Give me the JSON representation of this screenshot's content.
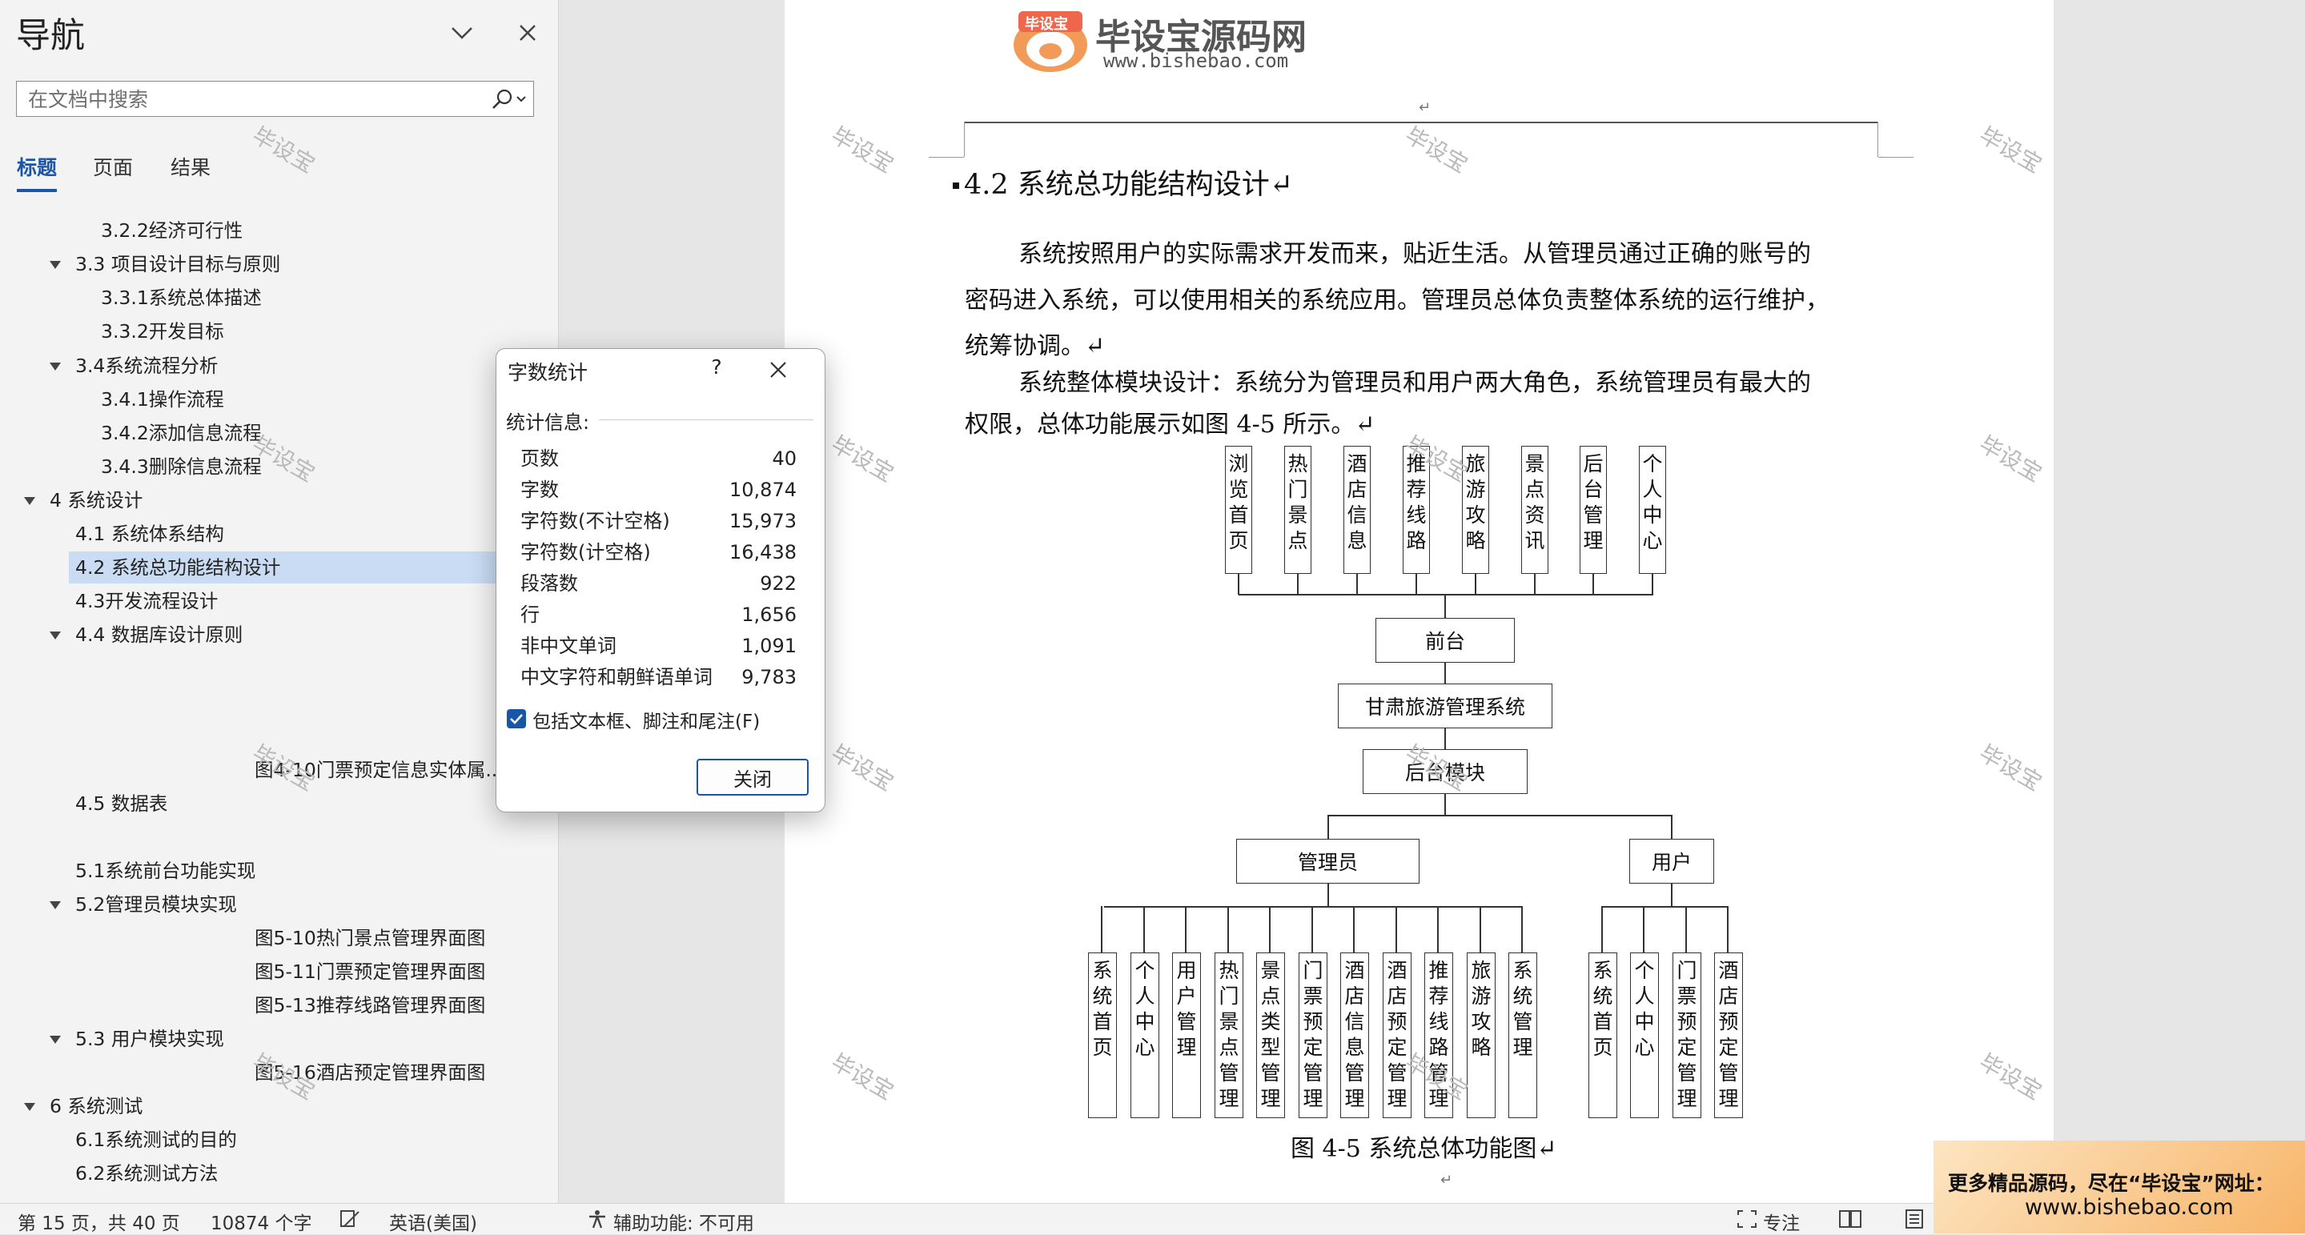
{
  "nav": {
    "title": "导航",
    "search_placeholder": "在文档中搜索",
    "tabs": [
      "标题",
      "页面",
      "结果"
    ],
    "items": [
      {
        "label": "3.2.2经济可行性",
        "level": 3,
        "expand": false
      },
      {
        "label": "3.3 项目设计目标与原则",
        "level": 2,
        "expand": true
      },
      {
        "label": "3.3.1系统总体描述",
        "level": 3,
        "expand": false
      },
      {
        "label": "3.3.2开发目标",
        "level": 3,
        "expand": false
      },
      {
        "label": "3.4系统流程分析",
        "level": 2,
        "expand": true
      },
      {
        "label": "3.4.1操作流程",
        "level": 3,
        "expand": false
      },
      {
        "label": "3.4.2添加信息流程",
        "level": 3,
        "expand": false
      },
      {
        "label": "3.4.3删除信息流程",
        "level": 3,
        "expand": false
      },
      {
        "label": "4 系统设计",
        "level": 1,
        "expand": true
      },
      {
        "label": "4.1 系统体系结构",
        "level": 2,
        "expand": false
      },
      {
        "label": "4.2 系统总功能结构设计",
        "level": 2,
        "expand": false,
        "selected": true
      },
      {
        "label": "4.3开发流程设计",
        "level": 2,
        "expand": false
      },
      {
        "label": "4.4 数据库设计原则",
        "level": 2,
        "expand": true
      },
      {
        "label": "图4-10门票预定信息实体属...",
        "level": 4,
        "expand": false
      },
      {
        "label": "4.5 数据表",
        "level": 2,
        "expand": false
      },
      {
        "label": "5.1系统前台功能实现",
        "level": 2,
        "expand": false
      },
      {
        "label": "5.2管理员模块实现",
        "level": 2,
        "expand": true
      },
      {
        "label": "图5-10热门景点管理界面图",
        "level": 4,
        "expand": false
      },
      {
        "label": "图5-11门票预定管理界面图",
        "level": 4,
        "expand": false
      },
      {
        "label": "图5-13推荐线路管理界面图",
        "level": 4,
        "expand": false
      },
      {
        "label": "5.3 用户模块实现",
        "level": 2,
        "expand": true
      },
      {
        "label": "图5-16酒店预定管理界面图",
        "level": 4,
        "expand": false
      },
      {
        "label": "6 系统测试",
        "level": 1,
        "expand": true
      },
      {
        "label": "6.1系统测试的目的",
        "level": 2,
        "expand": false
      },
      {
        "label": "6.2系统测试方法",
        "level": 2,
        "expand": false
      }
    ]
  },
  "doc": {
    "logo_badge": "毕设宝",
    "logo_title": "毕设宝源码网",
    "logo_url": "www.bishebao.com",
    "para_mark": "↵",
    "heading": "4.2  系统总功能结构设计↵",
    "paragraphs": [
      "系统按照用户的实际需求开发而来，贴近生活。从管理员通过正确的账号的",
      "密码进入系统，可以使用相关的系统应用。管理员总体负责整体系统的运行维护，",
      "统筹协调。↵",
      "系统整体模块设计：系统分为管理员和用户两大角色，系统管理员有最大的",
      "权限，总体功能展示如图 4-5 所示。↵"
    ],
    "watermark": "毕设宝",
    "caption": "图 4-5  系统总体功能图↵",
    "diagram": {
      "top_modules": [
        "浏览首页",
        "热门景点",
        "酒店信息",
        "推荐线路",
        "旅游攻略",
        "景点资讯",
        "后台管理",
        "个人中心"
      ],
      "frontend": "前台",
      "system": "甘肃旅游管理系统",
      "backend": "后台模块",
      "admin": "管理员",
      "user": "用户",
      "admin_modules": [
        "系统首页",
        "个人中心",
        "用户管理",
        "热门景点管理",
        "景点类型管理",
        "门票预定管理",
        "酒店信息管理",
        "酒店预定管理",
        "推荐线路管理",
        "旅游攻略",
        "系统管理"
      ],
      "user_modules": [
        "系统首页",
        "个人中心",
        "门票预定管理",
        "酒店预定管理"
      ]
    }
  },
  "dialog": {
    "title": "字数统计",
    "help": "?",
    "section": "统计信息:",
    "rows": [
      {
        "label": "页数",
        "value": "40"
      },
      {
        "label": "字数",
        "value": "10,874"
      },
      {
        "label": "字符数(不计空格)",
        "value": "15,973"
      },
      {
        "label": "字符数(计空格)",
        "value": "16,438"
      },
      {
        "label": "段落数",
        "value": "922"
      },
      {
        "label": "行",
        "value": "1,656"
      },
      {
        "label": "非中文单词",
        "value": "1,091"
      },
      {
        "label": "中文字符和朝鲜语单词",
        "value": "9,783"
      }
    ],
    "checkbox_label": "包括文本框、脚注和尾注(F)",
    "checkbox_checked": true,
    "close_label": "关闭"
  },
  "status": {
    "page": "第 15 页，共 40 页",
    "words": "10874 个字",
    "language": "英语(美国)",
    "accessibility": "辅助功能: 不可用",
    "focus": "专注"
  },
  "promo": {
    "line1": "更多精品源码，尽在“毕设宝”网址：",
    "line2": "www.bishebao.com"
  },
  "colors": {
    "accent": "#1a56a8",
    "selection": "#c9dcf3",
    "checkbox": "#1a56a8"
  }
}
